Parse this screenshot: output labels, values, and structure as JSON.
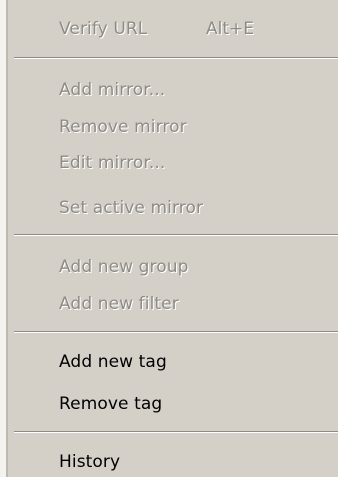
{
  "menu": {
    "items": [
      {
        "label": "Verify URL",
        "shortcut": "Alt+E",
        "enabled": false
      },
      {
        "label": "Add mirror...",
        "enabled": false
      },
      {
        "label": "Remove mirror",
        "enabled": false
      },
      {
        "label": "Edit mirror...",
        "enabled": false
      },
      {
        "label": "Set active mirror",
        "enabled": false
      },
      {
        "label": "Add new group",
        "enabled": false
      },
      {
        "label": "Add new filter",
        "enabled": false
      },
      {
        "label": "Add new tag",
        "enabled": true
      },
      {
        "label": "Remove tag",
        "enabled": true
      },
      {
        "label": "History",
        "enabled": true
      }
    ]
  },
  "colors": {
    "menu_background": "#d4d0c8",
    "disabled_text": "#8f8c85",
    "enabled_text": "#000000"
  }
}
